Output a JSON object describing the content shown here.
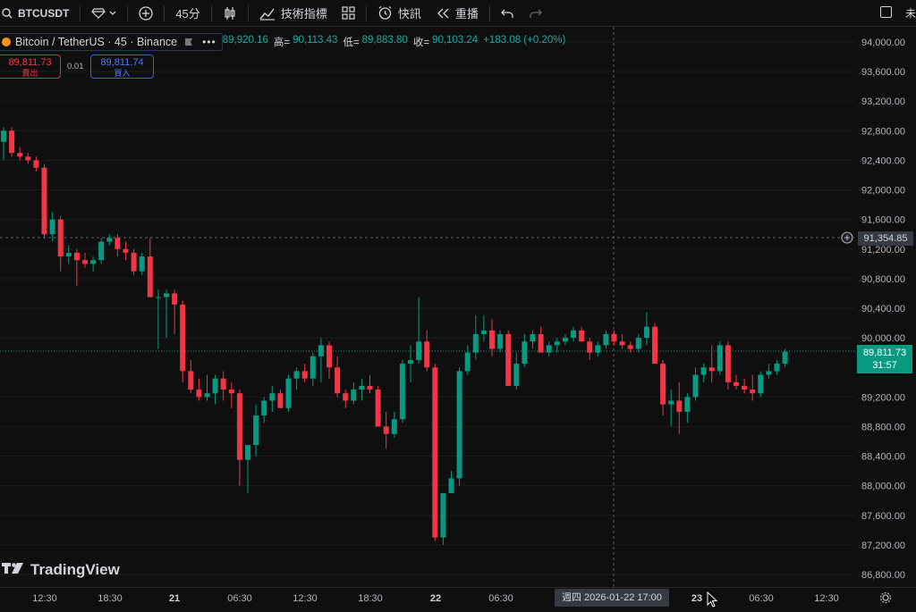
{
  "toolbar": {
    "symbol": "BTCUSDT",
    "interval": "45分",
    "indicators_label": "技術指標",
    "news_label": "快訊",
    "replay_label": "重播",
    "right_text": "未"
  },
  "legend": {
    "title": "Bitcoin / TetherUS · 45 · Binance",
    "open_value": "89,920.16",
    "high_label": "高=",
    "high_value": "90,113.43",
    "low_label": "低=",
    "low_value": "89,883.80",
    "close_label": "收=",
    "close_value": "90,103.24",
    "change": "+183.08 (+0.20%)"
  },
  "trade": {
    "sell_price": "89,811.73",
    "sell_label": "賣出",
    "spread": "0.01",
    "buy_price": "89,811.74",
    "buy_label": "買入"
  },
  "watermark": "TradingView",
  "price_tag": {
    "price": "89,811.73",
    "countdown": "31:57"
  },
  "crosshair": {
    "price": "91,354.85",
    "time": "週四  2026-01-22   17:00"
  },
  "colors": {
    "up": "#089981",
    "down": "#f23645",
    "background": "#0f0f0f"
  },
  "chart_data": {
    "type": "candlestick",
    "y_ticks": [
      "94,000.00",
      "93,600.00",
      "93,200.00",
      "92,800.00",
      "92,400.00",
      "92,000.00",
      "91,600.00",
      "91,200.00",
      "90,800.00",
      "90,400.00",
      "90,000.00",
      "89,200.00",
      "88,800.00",
      "88,400.00",
      "88,000.00",
      "87,600.00",
      "87,200.00",
      "86,800.00"
    ],
    "ylim": [
      86650,
      94200
    ],
    "x_ticks": [
      {
        "label": "12:30",
        "day": false
      },
      {
        "label": "18:30",
        "day": false
      },
      {
        "label": "21",
        "day": true
      },
      {
        "label": "06:30",
        "day": false
      },
      {
        "label": "12:30",
        "day": false
      },
      {
        "label": "18:30",
        "day": false
      },
      {
        "label": "22",
        "day": true
      },
      {
        "label": "06:30",
        "day": false
      },
      {
        "label": "23",
        "day": true
      },
      {
        "label": "06:30",
        "day": false
      },
      {
        "label": "12:30",
        "day": false
      }
    ],
    "candles": [
      [
        92650,
        92850,
        92400,
        92800
      ],
      [
        92800,
        92850,
        92450,
        92500
      ],
      [
        92500,
        92580,
        92400,
        92450
      ],
      [
        92450,
        92500,
        92350,
        92400
      ],
      [
        92400,
        92450,
        92250,
        92300
      ],
      [
        92300,
        92350,
        91350,
        91400
      ],
      [
        91400,
        91700,
        91300,
        91600
      ],
      [
        91600,
        91650,
        90900,
        91100
      ],
      [
        91100,
        91250,
        91000,
        91150
      ],
      [
        91150,
        91200,
        90700,
        91050
      ],
      [
        91050,
        91150,
        90950,
        91000
      ],
      [
        91000,
        91100,
        90900,
        91050
      ],
      [
        91050,
        91350,
        91000,
        91300
      ],
      [
        91300,
        91400,
        91250,
        91350
      ],
      [
        91350,
        91400,
        91100,
        91200
      ],
      [
        91200,
        91300,
        91050,
        91150
      ],
      [
        91150,
        91200,
        90850,
        90900
      ],
      [
        90900,
        91150,
        90850,
        91100
      ],
      [
        91100,
        91350,
        90700,
        90550
      ],
      [
        90550,
        90650,
        89850,
        90550
      ],
      [
        90550,
        90650,
        90000,
        90600
      ],
      [
        90600,
        90650,
        90050,
        90450
      ],
      [
        90450,
        90500,
        89400,
        89550
      ],
      [
        89550,
        89700,
        89250,
        89300
      ],
      [
        89300,
        89450,
        89150,
        89200
      ],
      [
        89200,
        89500,
        89150,
        89250
      ],
      [
        89250,
        89500,
        89100,
        89450
      ],
      [
        89450,
        89550,
        89150,
        89300
      ],
      [
        89300,
        89400,
        89050,
        89250
      ],
      [
        89250,
        89300,
        88000,
        88350
      ],
      [
        88350,
        88500,
        87900,
        88550
      ],
      [
        88550,
        89100,
        88400,
        88950
      ],
      [
        88950,
        89200,
        88850,
        89150
      ],
      [
        89150,
        89350,
        89000,
        89250
      ],
      [
        89250,
        89300,
        89050,
        89050
      ],
      [
        89050,
        89500,
        89000,
        89450
      ],
      [
        89450,
        89600,
        89300,
        89550
      ],
      [
        89550,
        89650,
        89400,
        89450
      ],
      [
        89450,
        89800,
        89350,
        89750
      ],
      [
        89750,
        90000,
        89400,
        89900
      ],
      [
        89900,
        89950,
        89450,
        89600
      ],
      [
        89600,
        89750,
        89200,
        89250
      ],
      [
        89250,
        89300,
        89050,
        89150
      ],
      [
        89150,
        89400,
        89100,
        89300
      ],
      [
        89300,
        89450,
        89150,
        89350
      ],
      [
        89350,
        89500,
        89250,
        89300
      ],
      [
        89300,
        89350,
        88850,
        88800
      ],
      [
        88800,
        89000,
        88500,
        88700
      ],
      [
        88700,
        89000,
        88650,
        88900
      ],
      [
        88900,
        89700,
        88850,
        89650
      ],
      [
        89650,
        89900,
        89400,
        89700
      ],
      [
        89700,
        90550,
        89650,
        89950
      ],
      [
        89950,
        90100,
        89550,
        89600
      ],
      [
        89600,
        89650,
        87250,
        87300
      ],
      [
        87300,
        87350,
        87200,
        87900
      ],
      [
        87900,
        88200,
        87900,
        88100
      ],
      [
        88100,
        89600,
        88000,
        89550
      ],
      [
        89550,
        89900,
        89500,
        89800
      ],
      [
        89800,
        90300,
        89700,
        90050
      ],
      [
        90050,
        90300,
        89950,
        90100
      ],
      [
        90100,
        90250,
        89750,
        89850
      ],
      [
        89850,
        90100,
        89800,
        90050
      ],
      [
        90050,
        90100,
        89350,
        89350
      ],
      [
        89350,
        89800,
        89300,
        89650
      ],
      [
        89650,
        90050,
        89600,
        89950
      ],
      [
        89950,
        90100,
        89850,
        90050
      ],
      [
        90050,
        90150,
        89900,
        89800
      ],
      [
        89800,
        89950,
        89750,
        89900
      ],
      [
        89900,
        90000,
        89800,
        89950
      ],
      [
        89950,
        90050,
        89900,
        90000
      ],
      [
        90000,
        90150,
        89950,
        90100
      ],
      [
        90100,
        90150,
        89950,
        89950
      ],
      [
        89950,
        90000,
        89700,
        89800
      ],
      [
        89800,
        89950,
        89750,
        89900
      ],
      [
        89900,
        90100,
        89850,
        90050
      ],
      [
        90050,
        90100,
        89900,
        89950
      ],
      [
        89950,
        90050,
        89850,
        89900
      ],
      [
        89900,
        89950,
        89800,
        89850
      ],
      [
        89850,
        90050,
        89800,
        90000
      ],
      [
        90000,
        90350,
        89900,
        90150
      ],
      [
        90150,
        90200,
        89650,
        89650
      ],
      [
        89650,
        89700,
        88950,
        89100
      ],
      [
        89100,
        89300,
        88800,
        89150
      ],
      [
        89150,
        89400,
        88700,
        89000
      ],
      [
        89000,
        89250,
        88850,
        89200
      ],
      [
        89200,
        89600,
        89150,
        89500
      ],
      [
        89500,
        89650,
        89400,
        89600
      ],
      [
        89600,
        89900,
        89400,
        89550
      ],
      [
        89550,
        89950,
        89500,
        89900
      ],
      [
        89900,
        89950,
        89300,
        89400
      ],
      [
        89400,
        89500,
        89300,
        89350
      ],
      [
        89350,
        89450,
        89250,
        89300
      ],
      [
        89300,
        89500,
        89150,
        89250
      ],
      [
        89250,
        89550,
        89200,
        89500
      ],
      [
        89500,
        89650,
        89450,
        89550
      ],
      [
        89550,
        89700,
        89500,
        89650
      ],
      [
        89650,
        89850,
        89600,
        89811.73
      ]
    ]
  }
}
